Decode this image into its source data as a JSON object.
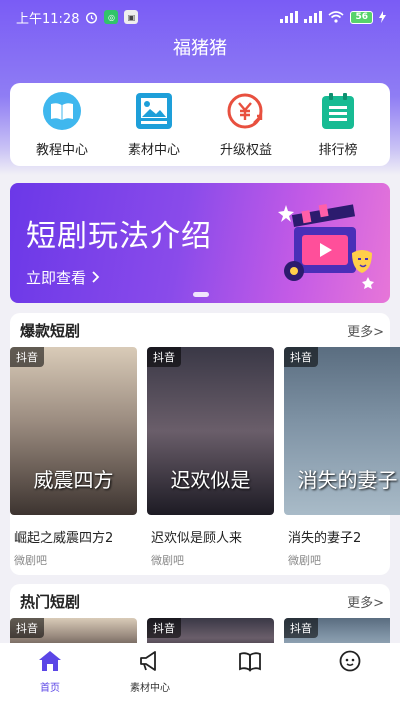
{
  "status_bar": {
    "time": "上午11:28",
    "battery": "56"
  },
  "app": {
    "title": "福猪猪"
  },
  "shortcuts": [
    {
      "label": "教程中心",
      "icon": "book-icon"
    },
    {
      "label": "素材中心",
      "icon": "image-icon"
    },
    {
      "label": "升级权益",
      "icon": "upgrade-yen-icon"
    },
    {
      "label": "排行榜",
      "icon": "calendar-list-icon"
    }
  ],
  "banner": {
    "title": "短剧玩法介绍",
    "link_label": "立即查看"
  },
  "hot_section": {
    "title": "爆款短剧",
    "more_label": "更多>",
    "items": [
      {
        "tag": "抖音",
        "poster_text": "威震四方",
        "name": "崛起之威震四方2",
        "source": "微剧吧"
      },
      {
        "tag": "抖音",
        "poster_text": "迟欢似是",
        "name": "迟欢似是顾人来",
        "source": "微剧吧"
      },
      {
        "tag": "抖音",
        "poster_text": "消失的妻子",
        "name": "消失的妻子2",
        "source": "微剧吧"
      }
    ]
  },
  "trend_section": {
    "title": "热门短剧",
    "more_label": "更多>",
    "items": [
      {
        "tag": "抖音"
      },
      {
        "tag": "抖音"
      },
      {
        "tag": "抖音"
      }
    ]
  },
  "tab_bar": {
    "items": [
      {
        "label": "首页",
        "active": true
      },
      {
        "label": "素材中心",
        "active": false
      },
      {
        "label": "",
        "active": false
      },
      {
        "label": "",
        "active": false
      }
    ]
  },
  "colors": {
    "accent": "#5b46e6",
    "header_gradient_top": "#7a5cf5",
    "banner_start": "#6b38e8",
    "banner_end": "#e776d8"
  }
}
